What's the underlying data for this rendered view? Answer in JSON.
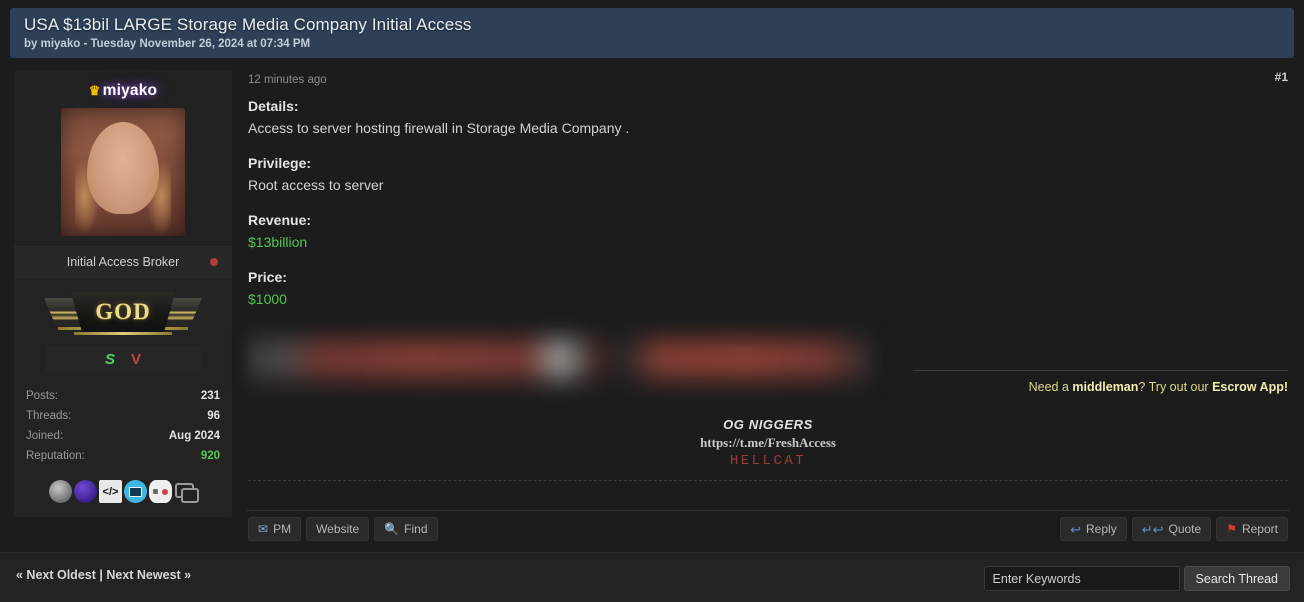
{
  "thread": {
    "title": "USA $13bil LARGE Storage Media Company Initial Access",
    "byline": "by miyako - Tuesday November 26, 2024 at 07:34 PM"
  },
  "author": {
    "username": "miyako",
    "crown_icon": "crown-icon",
    "usertitle": "Initial Access Broker",
    "status": "offline",
    "status_color": "#b33c3c",
    "rank_banner_text": "GOD",
    "badges": [
      {
        "name": "badge-s",
        "label": "S",
        "color": "#4bd46a"
      },
      {
        "name": "badge-v",
        "label": "V",
        "color": "#c4453f"
      }
    ],
    "stats": [
      {
        "label": "Posts:",
        "value": "231"
      },
      {
        "label": "Threads:",
        "value": "96"
      },
      {
        "label": "Joined:",
        "value": "Aug 2024"
      },
      {
        "label": "Reputation:",
        "value": "920",
        "highlight": "#56c955"
      }
    ],
    "awards": [
      "anvil-award-icon",
      "discord-award-icon",
      "code-award-icon",
      "monitor-award-icon",
      "gamepad-award-icon",
      "chat-award-icon"
    ]
  },
  "post": {
    "date": "12 minutes ago",
    "number": "#1",
    "sections": [
      {
        "label": "Details:",
        "text": "Access to server hosting firewall in Storage Media Company .",
        "color": "normal"
      },
      {
        "label": "Privilege:",
        "text": "Root access to server",
        "color": "normal"
      },
      {
        "label": "Revenue:",
        "text": "$13billion",
        "color": "green"
      },
      {
        "label": "Price:",
        "text": "$1000",
        "color": "green"
      }
    ],
    "redacted_note": "blurred-redacted-content",
    "middleman": {
      "prefix": "Need a ",
      "bold1": "middleman",
      "middle": "? Try out our ",
      "bold2": "Escrow App!"
    },
    "signature": {
      "line1": "OG NIGGERS",
      "line2": "https://t.me/FreshAccess",
      "line3": "HELLCAT"
    },
    "left_buttons": [
      {
        "name": "pm-button",
        "label": "PM",
        "icon": "mail-icon"
      },
      {
        "name": "website-button",
        "label": "Website",
        "icon": ""
      },
      {
        "name": "find-button",
        "label": "Find",
        "icon": "search-icon"
      }
    ],
    "right_buttons": [
      {
        "name": "reply-button",
        "label": "Reply",
        "icon": "reply-arrow-icon"
      },
      {
        "name": "quote-button",
        "label": "Quote",
        "icon": "quote-arrows-icon"
      },
      {
        "name": "report-button",
        "label": "Report",
        "icon": "flag-icon"
      }
    ]
  },
  "footer": {
    "next_oldest": "« Next Oldest",
    "divider": " | ",
    "next_newest": "Next Newest »",
    "search_placeholder": "Enter Keywords",
    "search_value": "",
    "search_button": "Search Thread"
  },
  "colors": {
    "header_bg": "#2e3f56",
    "page_bg": "#1c1c1c",
    "panel_bg": "#232323",
    "accent_green": "#51c64f",
    "accent_yellow": "#e0d88a",
    "accent_red": "#cf3b34"
  }
}
